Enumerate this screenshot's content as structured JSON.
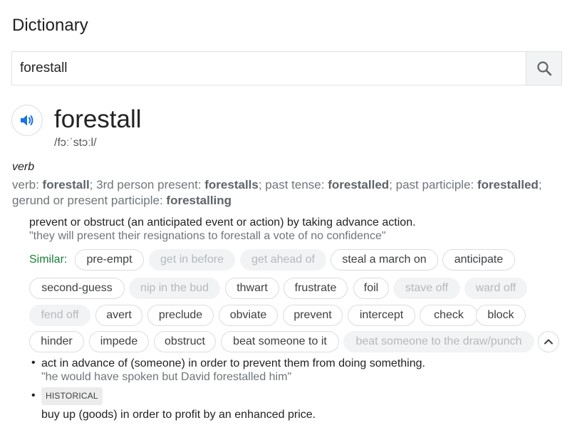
{
  "header": {
    "title": "Dictionary"
  },
  "search": {
    "value": "forestall",
    "icon": "search-icon"
  },
  "entry": {
    "word": "forestall",
    "phonetic": "/fɔːˈstɔːl/",
    "part_of_speech": "verb",
    "forms": {
      "lead": "verb: ",
      "base": "forestall",
      "sep1": "; 3rd person present: ",
      "third_person": "forestalls",
      "sep2": "; past tense: ",
      "past": "forestalled",
      "sep3": "; past participle: ",
      "past_participle": "forestalled",
      "sep4": ";",
      "sep5": "gerund or present participle: ",
      "gerund": "forestalling"
    }
  },
  "senses": [
    {
      "definition": "prevent or obstruct (an anticipated event or action) by taking advance action.",
      "example": "\"they will present their resignations to forestall a vote of no confidence\""
    },
    {
      "definition": "act in advance of (someone) in order to prevent them from doing something.",
      "example": "\"he would have spoken but David forestalled him\""
    },
    {
      "tag": "HISTORICAL",
      "definition": "buy up (goods) in order to profit by an enhanced price."
    }
  ],
  "similar": {
    "label": "Similar:",
    "chips": [
      {
        "label": "pre-empt",
        "muted": false
      },
      {
        "label": "get in before",
        "muted": true
      },
      {
        "label": "get ahead of",
        "muted": true
      },
      {
        "label": "steal a march on",
        "muted": false
      },
      {
        "label": "anticipate",
        "muted": false
      },
      {
        "label": "second-guess",
        "muted": false
      },
      {
        "label": "nip in the bud",
        "muted": true
      },
      {
        "label": "thwart",
        "muted": false
      },
      {
        "label": "frustrate",
        "muted": false
      },
      {
        "label": "foil",
        "muted": false
      },
      {
        "label": "stave off",
        "muted": true
      },
      {
        "label": "ward off",
        "muted": true
      },
      {
        "label": "fend off",
        "muted": true
      },
      {
        "label": "avert",
        "muted": false
      },
      {
        "label": "preclude",
        "muted": false
      },
      {
        "label": "obviate",
        "muted": false
      },
      {
        "label": "prevent",
        "muted": false
      },
      {
        "label": "intercept",
        "muted": false
      },
      {
        "label": "check",
        "muted": false
      },
      {
        "label": "block",
        "muted": false
      },
      {
        "label": "hinder",
        "muted": false
      },
      {
        "label": "impede",
        "muted": false
      },
      {
        "label": "obstruct",
        "muted": false
      },
      {
        "label": "beat someone to it",
        "muted": false
      },
      {
        "label": "beat someone to the draw/punch",
        "muted": true
      }
    ]
  },
  "colors": {
    "accent_blue": "#1a73e8",
    "similar_green": "#188038",
    "muted_chip_bg": "#f1f3f4"
  }
}
